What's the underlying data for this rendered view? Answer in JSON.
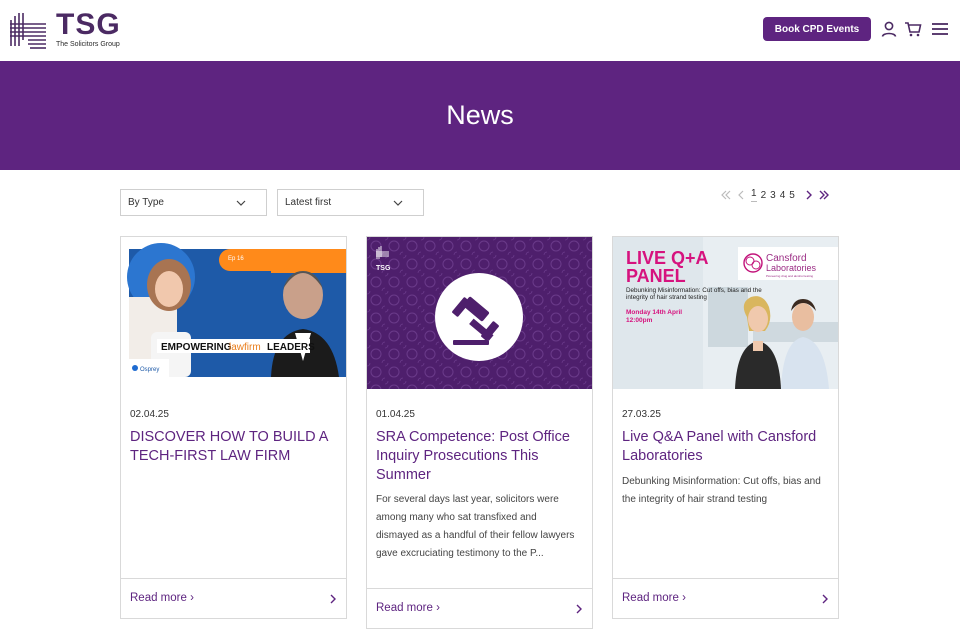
{
  "header": {
    "logo_title": "TSG",
    "logo_subtitle": "The Solicitors Group",
    "cpd_button": "Book CPD Events",
    "icons": [
      "user-icon",
      "cart-icon",
      "menu-icon"
    ]
  },
  "banner": {
    "title": "News"
  },
  "filters": {
    "type_select": "By Type",
    "sort_select": "Latest first"
  },
  "pagination": {
    "pages": [
      "1",
      "2",
      "3",
      "4",
      "5"
    ],
    "current": "1"
  },
  "colors": {
    "brand": "#5e2480",
    "border": "#d9d9d9"
  },
  "cards": [
    {
      "date": "02.04.25",
      "title": "DISCOVER HOW TO BUILD A TECH-FIRST LAW FIRM",
      "excerpt": "",
      "read_more": "Read more ›",
      "image_text": {
        "tag": "Ep 16",
        "headline_a": "EMPOWERING",
        "headline_b": "lawfirm",
        "headline_c": "LEADERS",
        "brand": "Osprey"
      }
    },
    {
      "date": "01.04.25",
      "title": "SRA Competence: Post Office Inquiry Prosecutions This Summer",
      "excerpt": "For several days last year, solicitors were among many who sat transfixed and dismayed as a handful of their fellow lawyers gave excruciating testimony to the P...",
      "read_more": "Read more ›",
      "image_text": {
        "logo": "TSG"
      }
    },
    {
      "date": "27.03.25",
      "title": "Live Q&A Panel with Cansford Laboratories",
      "excerpt": "Debunking Misinformation: Cut offs, bias and the integrity of hair strand testing",
      "read_more": "Read more ›",
      "image_text": {
        "headline_1": "LIVE Q+A",
        "headline_2": "PANEL",
        "brand_1": "Cansford",
        "brand_2": "Laboratories",
        "brand_tag": "Pioneering drug and alcohol testing",
        "subtitle": "Debunking Misinformation: Cut offs, bias and the integrity of hair strand testing",
        "date": "Monday 14th April",
        "time": "12:00pm"
      }
    }
  ]
}
